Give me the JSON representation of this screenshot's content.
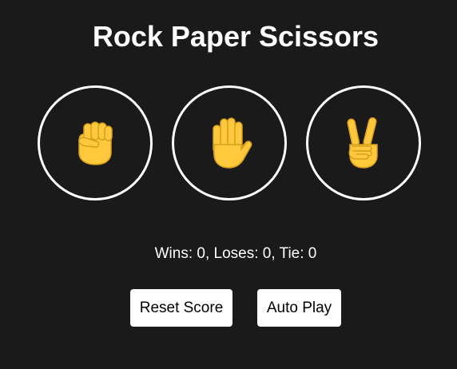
{
  "title": "Rock Paper Scissors",
  "moves": [
    {
      "name": "rock",
      "icon": "raised-fist-icon"
    },
    {
      "name": "paper",
      "icon": "raised-hand-icon"
    },
    {
      "name": "scissors",
      "icon": "victory-hand-icon"
    }
  ],
  "score": {
    "text": "Wins: 0, Loses: 0, Tie: 0",
    "wins": 0,
    "losses": 0,
    "ties": 0
  },
  "buttons": {
    "reset_label": "Reset Score",
    "auto_play_label": "Auto Play"
  },
  "colors": {
    "background": "#1a1a1a",
    "emoji_skin": "#ffc83d",
    "emoji_outline": "#d6a01c"
  }
}
